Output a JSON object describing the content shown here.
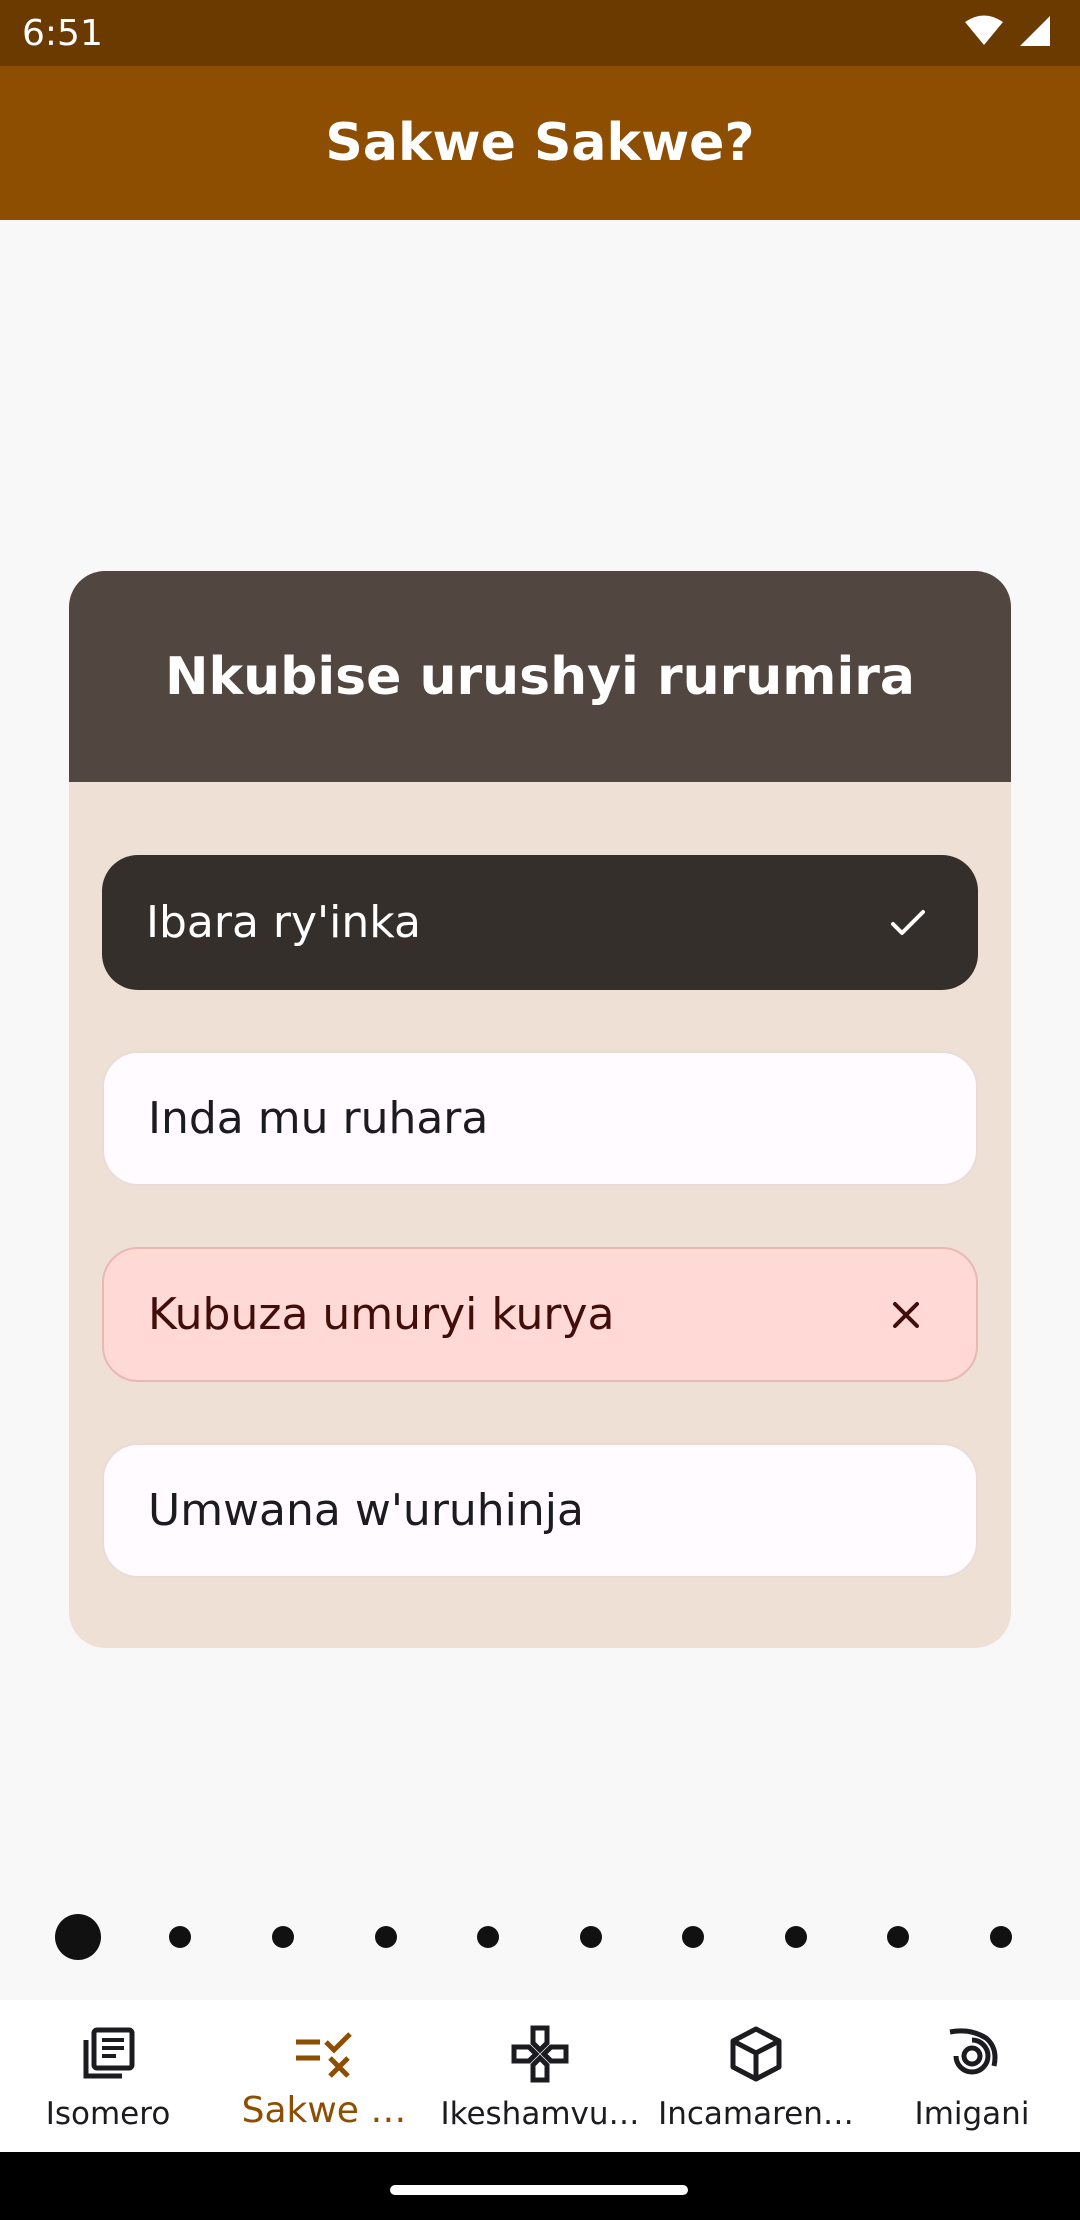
{
  "status_bar": {
    "time": "6:51",
    "icons": [
      "wifi-icon",
      "signal-icon"
    ]
  },
  "app_bar": {
    "title": "Sakwe Sakwe?"
  },
  "quiz": {
    "question": "Nkubise urushyi rurumira",
    "options": [
      {
        "label": "Ibara ry'inka",
        "state": "correct",
        "icon": "check-icon"
      },
      {
        "label": "Inda mu ruhara",
        "state": "default"
      },
      {
        "label": "Kubuza umuryi kurya",
        "state": "wrong",
        "icon": "close-icon"
      },
      {
        "label": "Umwana w'uruhinja",
        "state": "default"
      }
    ]
  },
  "pager": {
    "total": 10,
    "current": 1
  },
  "bottom_nav": {
    "items": [
      {
        "label": "Isomero",
        "icon": "library-books-icon",
        "active": false
      },
      {
        "label": "Sakwe …",
        "icon": "checklist-x-icon",
        "active": true
      },
      {
        "label": "Ikeshamvu…",
        "icon": "game-controller-icon",
        "active": false
      },
      {
        "label": "Incamaren…",
        "icon": "cube-icon",
        "active": false
      },
      {
        "label": "Imigani",
        "icon": "spiral-icon",
        "active": false
      }
    ]
  },
  "colors": {
    "status_bar": "#6b3a00",
    "app_bar": "#8e4e02",
    "card_header": "#524640",
    "card_body": "#efe0d6",
    "selected_option": "#352f2b",
    "wrong_option": "#ffd9d5",
    "active_nav": "#8e4e02"
  }
}
